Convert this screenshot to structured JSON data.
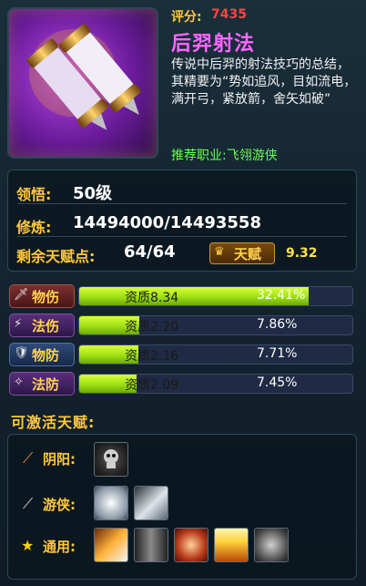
{
  "item": {
    "score_label": "评分:",
    "score_value": "7435",
    "name": "后羿射法",
    "description": "传说中后羿的射法技巧的总结，其精要为“势如追风，目如流电，满开弓，紧放箭，舍矢如破”",
    "recommend_job": "推荐职业:飞翎游侠",
    "icon": "scroll-icon"
  },
  "stats": {
    "comprehension_label": "领悟:",
    "comprehension_value": "50级",
    "cultivation_label": "修炼:",
    "cultivation_value": "14494000/14493558",
    "remaining_label": "剩余天赋点:",
    "remaining_value": "64/64",
    "talent_button": "天赋",
    "talent_multiplier": "9.32"
  },
  "bars": [
    {
      "label": "物伤",
      "icon": "sword-icon",
      "quality": "资质8.34",
      "percent_text": "32.41%",
      "fill": 0.84,
      "color": "#a65050"
    },
    {
      "label": "法伤",
      "icon": "magic-icon",
      "quality": "资质2.20",
      "percent_text": "7.86%",
      "fill": 0.22,
      "color": "#8050a6"
    },
    {
      "label": "物防",
      "icon": "shield-icon",
      "quality": "资质2.16",
      "percent_text": "7.71%",
      "fill": 0.216,
      "color": "#5070a6"
    },
    {
      "label": "法防",
      "icon": "magic-shield-icon",
      "quality": "资质2.09",
      "percent_text": "7.45%",
      "fill": 0.209,
      "color": "#8050a6"
    }
  ],
  "activatable": {
    "title": "可激活天赋:",
    "categories": [
      {
        "label": "阴阳:",
        "icon": "bow-icon"
      },
      {
        "label": "游侠:",
        "icon": "bow-icon"
      },
      {
        "label": "通用:",
        "icon": "star-icon"
      }
    ]
  }
}
